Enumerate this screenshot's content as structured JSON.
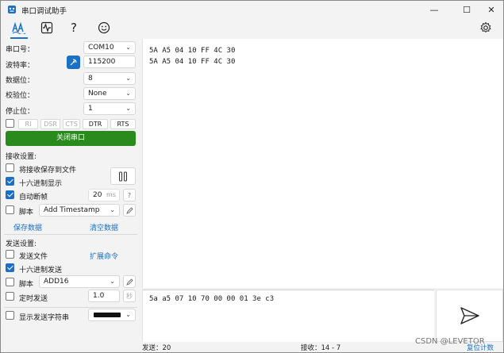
{
  "window": {
    "title": "串口调试助手",
    "minimize": "—",
    "maximize": "☐",
    "close": "✕"
  },
  "toolbar": {
    "icons": [
      "waveform-text-icon",
      "oscilloscope-icon",
      "help-icon",
      "smiley-icon",
      "settings-icon"
    ],
    "help_glyph": "?"
  },
  "serial": {
    "port_label": "串口号：",
    "port_value": "COM10",
    "baud_label": "波特率：",
    "baud_value": "115200",
    "databits_label": "数据位：",
    "databits_value": "8",
    "parity_label": "校验位：",
    "parity_value": "None",
    "stopbits_label": "停止位：",
    "stopbits_value": "1",
    "signals": [
      "RI",
      "DSR",
      "CTS",
      "DTR",
      "RTS"
    ],
    "open_button": "关闭串口"
  },
  "receive": {
    "section_label": "接收设置:",
    "save_to_file": "将接收保存到文件",
    "hex_display": "十六进制显示",
    "auto_break": "自动断帧",
    "auto_break_value": "20",
    "auto_break_unit": "ms",
    "auto_break_help": "?",
    "script_label": "脚本",
    "script_value": "Add Timestamp",
    "save_data": "保存数据",
    "clear_data": "清空数据",
    "lines": [
      "5A A5 04 10 FF 4C 30",
      "5A A5 04 10 FF 4C 30"
    ]
  },
  "send": {
    "section_label": "发送设置:",
    "send_file": "发送文件",
    "extend_cmd": "扩展命令",
    "hex_send": "十六进制发送",
    "script_label": "脚本",
    "script_value": "ADD16",
    "timed_send": "定时发送",
    "timed_value": "1.0",
    "timed_unit": "秒",
    "show_string": "显示发送字符串",
    "content": "5a a5 07 10 70 00 00 01 3e c3"
  },
  "status": {
    "sent": "发送：20",
    "received": "接收：14 - 7",
    "reset": "复位计数"
  },
  "watermark": "CSDN @LEVETOR",
  "colors": {
    "accent": "#1a6fc6",
    "open_button": "#2a8a1e"
  }
}
